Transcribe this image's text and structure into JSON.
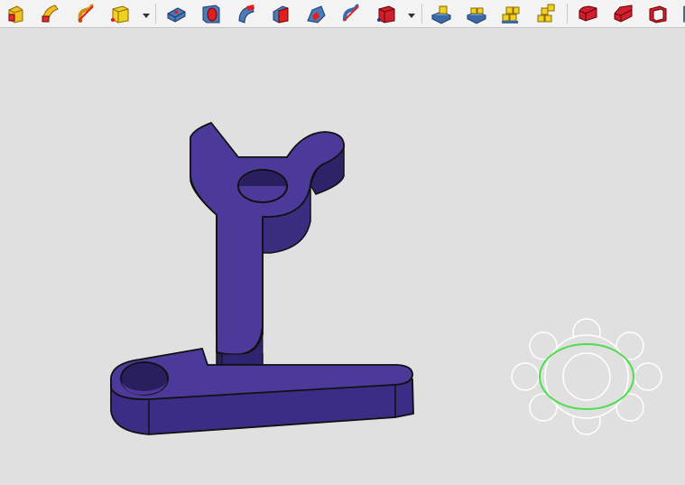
{
  "toolbar": {
    "groups": [
      {
        "name": "part-primitives",
        "items": [
          {
            "icon": "extrude-icon"
          },
          {
            "icon": "revolve-icon"
          },
          {
            "icon": "mirror-icon"
          },
          {
            "icon": "fillet-icon"
          }
        ],
        "has_dropdown": true
      },
      {
        "name": "part-tools",
        "items": [
          {
            "icon": "pad-icon"
          },
          {
            "icon": "pocket-icon"
          },
          {
            "icon": "groove-icon"
          },
          {
            "icon": "chamfer-icon"
          },
          {
            "icon": "draft-icon"
          },
          {
            "icon": "twist-icon"
          },
          {
            "icon": "box-icon"
          }
        ],
        "has_dropdown": true
      },
      {
        "name": "boolean-tools",
        "items": [
          {
            "icon": "cut-icon"
          },
          {
            "icon": "fuse-icon"
          },
          {
            "icon": "common-icon"
          },
          {
            "icon": "slice-icon"
          }
        ],
        "has_dropdown": false
      },
      {
        "name": "view-tools",
        "items": [
          {
            "icon": "fillet-edge-icon"
          },
          {
            "icon": "chamfer-edge-icon"
          },
          {
            "icon": "thickness-icon"
          }
        ],
        "has_dropdown": false
      }
    ]
  },
  "viewport": {
    "part_color": "#4b3a9a",
    "navigation_cube": {
      "icon": "navigation-cube-icon",
      "highlight_color": "#4ddd4d"
    }
  }
}
